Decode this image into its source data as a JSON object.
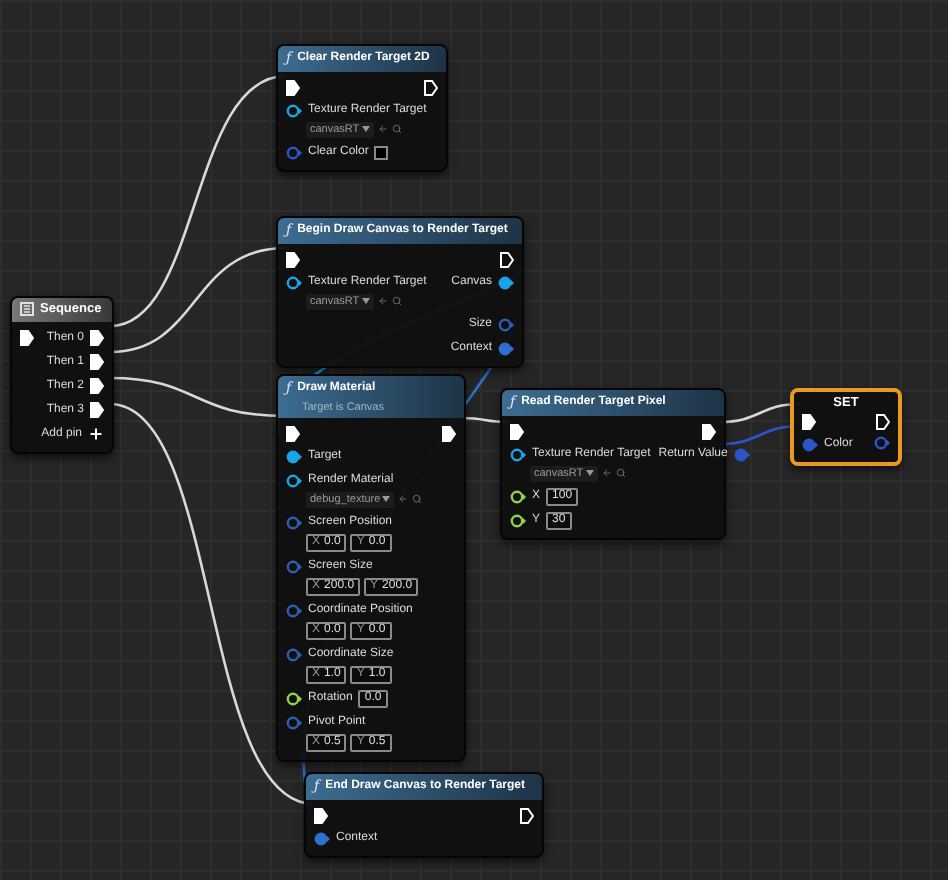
{
  "nodes": [
    {
      "title": "Clear Render Target 2D",
      "kind": "function",
      "icon": "ƒ",
      "selected": false,
      "rows": [
        {
          "in": {
            "kind": "exec",
            "connected": true
          },
          "out": {
            "kind": "exec",
            "connected": false
          }
        },
        {
          "in": {
            "kind": "object",
            "label": "Texture Render Target",
            "connected": false,
            "asset": "canvasRT"
          }
        },
        {
          "in": {
            "kind": "color",
            "label": "Clear Color",
            "connected": false,
            "color": "#000000"
          }
        }
      ]
    },
    {
      "title": "Begin Draw Canvas to Render Target",
      "kind": "function",
      "icon": "ƒ",
      "selected": false,
      "rows": [
        {
          "in": {
            "kind": "exec",
            "connected": true
          },
          "out": {
            "kind": "exec",
            "connected": false
          }
        },
        {
          "in": {
            "kind": "object",
            "label": "Texture Render Target",
            "connected": false,
            "asset": "canvasRT"
          },
          "out": {
            "kind": "object",
            "label": "Canvas",
            "connected": true
          }
        },
        {
          "out": {
            "kind": "vector",
            "label": "Size",
            "connected": false
          }
        },
        {
          "out": {
            "kind": "struct",
            "label": "Context",
            "connected": true
          }
        }
      ]
    },
    {
      "title": "Sequence",
      "kind": "flow",
      "selected": false,
      "rows": [
        {
          "in": {
            "kind": "exec",
            "connected": true
          },
          "out": {
            "kind": "exec",
            "label": "Then 0",
            "connected": true
          }
        },
        {
          "out": {
            "kind": "exec",
            "label": "Then 1",
            "connected": true
          }
        },
        {
          "out": {
            "kind": "exec",
            "label": "Then 2",
            "connected": true
          }
        },
        {
          "out": {
            "kind": "exec",
            "label": "Then 3",
            "connected": true
          }
        },
        {
          "out": {
            "kind": "add",
            "label": "Add pin"
          }
        }
      ]
    },
    {
      "title": "Draw Material",
      "subtitle": "Target is Canvas",
      "kind": "function",
      "icon": "ƒ",
      "selected": false,
      "rows": [
        {
          "in": {
            "kind": "exec",
            "connected": true
          },
          "out": {
            "kind": "exec",
            "connected": true
          }
        },
        {
          "in": {
            "kind": "object",
            "label": "Target",
            "connected": true
          }
        },
        {
          "in": {
            "kind": "object",
            "label": "Render Material",
            "connected": false,
            "asset": "debug_texture"
          }
        },
        {
          "in": {
            "kind": "vector",
            "label": "Screen Position",
            "connected": false,
            "fields": [
              {
                "axis": "X",
                "value": "0.0"
              },
              {
                "axis": "Y",
                "value": "0.0"
              }
            ]
          }
        },
        {
          "in": {
            "kind": "vector",
            "label": "Screen Size",
            "connected": false,
            "fields": [
              {
                "axis": "X",
                "value": "200.0"
              },
              {
                "axis": "Y",
                "value": "200.0"
              }
            ]
          }
        },
        {
          "in": {
            "kind": "vector",
            "label": "Coordinate Position",
            "connected": false,
            "fields": [
              {
                "axis": "X",
                "value": "0.0"
              },
              {
                "axis": "Y",
                "value": "0.0"
              }
            ]
          }
        },
        {
          "in": {
            "kind": "vector",
            "label": "Coordinate Size",
            "connected": false,
            "fields": [
              {
                "axis": "X",
                "value": "1.0"
              },
              {
                "axis": "Y",
                "value": "1.0"
              }
            ]
          }
        },
        {
          "in": {
            "kind": "float",
            "label": "Rotation",
            "connected": false,
            "value": "0.0"
          }
        },
        {
          "in": {
            "kind": "vector",
            "label": "Pivot Point",
            "connected": false,
            "fields": [
              {
                "axis": "X",
                "value": "0.5"
              },
              {
                "axis": "Y",
                "value": "0.5"
              }
            ]
          }
        }
      ]
    },
    {
      "title": "Read Render Target Pixel",
      "kind": "function",
      "icon": "ƒ",
      "selected": false,
      "rows": [
        {
          "in": {
            "kind": "exec",
            "connected": true
          },
          "out": {
            "kind": "exec",
            "connected": true
          }
        },
        {
          "in": {
            "kind": "object",
            "label": "Texture Render Target",
            "connected": false,
            "asset": "canvasRT"
          },
          "out": {
            "kind": "color",
            "label": "Return Value",
            "connected": true
          }
        },
        {
          "in": {
            "kind": "float",
            "label": "X",
            "connected": false,
            "value": "100"
          }
        },
        {
          "in": {
            "kind": "float",
            "label": "Y",
            "connected": false,
            "value": "30"
          }
        }
      ]
    },
    {
      "title": "SET",
      "kind": "variable",
      "selected": true,
      "rows": [
        {
          "in": {
            "kind": "exec",
            "connected": true
          },
          "out": {
            "kind": "exec",
            "connected": false
          }
        },
        {
          "in": {
            "kind": "color",
            "label": "Color",
            "connected": true
          },
          "out": {
            "kind": "color",
            "connected": false
          }
        }
      ]
    },
    {
      "title": "End Draw Canvas to Render Target",
      "kind": "function",
      "icon": "ƒ",
      "selected": false,
      "rows": [
        {
          "in": {
            "kind": "exec",
            "connected": true
          },
          "out": {
            "kind": "exec",
            "connected": false
          }
        },
        {
          "in": {
            "kind": "struct",
            "label": "Context",
            "connected": true
          }
        }
      ]
    }
  ]
}
